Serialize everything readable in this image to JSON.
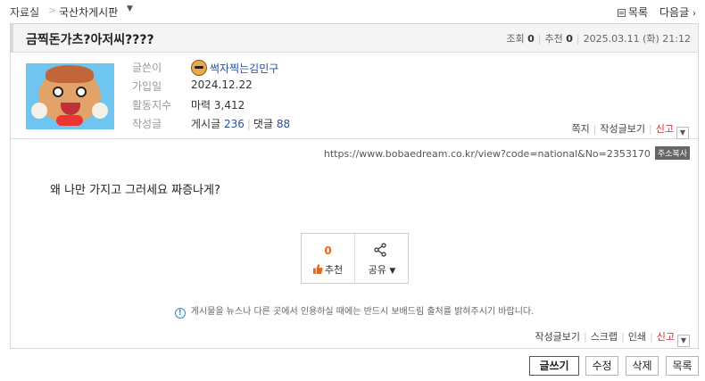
{
  "breadcrumb": {
    "home": "자료실",
    "separator": ">",
    "board": "국산차게시판"
  },
  "nav": {
    "list_label": "목록",
    "next_label": "다음글"
  },
  "post": {
    "title": "금찍돈가츠?아저씨????",
    "views_label": "조회",
    "views": "0",
    "recs_label": "추천",
    "recs": "0",
    "datetime": "2025.03.11 (화) 21:12"
  },
  "author": {
    "labels": {
      "nick": "글쓴이",
      "joined": "가입일",
      "activity": "활동지수",
      "posts": "작성글"
    },
    "nickname": "썩자찍는김민구",
    "joined": "2024.12.22",
    "activity": "마력 3,412",
    "posts_label": "게시글",
    "posts_count": "236",
    "comments_label": "댓글",
    "comments_count": "88"
  },
  "author_actions": {
    "message": "쪽지",
    "written": "작성글보기",
    "report": "신고"
  },
  "url": {
    "text": "https://www.bobaedream.co.kr/view?code=national&No=2353170",
    "copy_label": "주소복사"
  },
  "body": {
    "text": "왜 나만 가지고 그러세요 짜증나게?"
  },
  "vote": {
    "count": "0",
    "recommend_label": "추천",
    "share_label": "공유"
  },
  "notice": {
    "text": "게시물을 뉴스나 다른 곳에서 인용하실 때에는 반드시 보배드림 출처를 밝혀주시기 바랍니다."
  },
  "bottom_actions": {
    "written": "작성글보기",
    "scrap": "스크랩",
    "print": "인쇄",
    "report": "신고"
  },
  "buttons": {
    "write": "글쓰기",
    "edit": "수정",
    "delete": "삭제",
    "list": "목록"
  },
  "colors": {
    "accent_red": "#d9262a",
    "link_blue": "#2a4f9a",
    "recommend_orange": "#e8661a",
    "info_blue": "#2d8fd5"
  }
}
